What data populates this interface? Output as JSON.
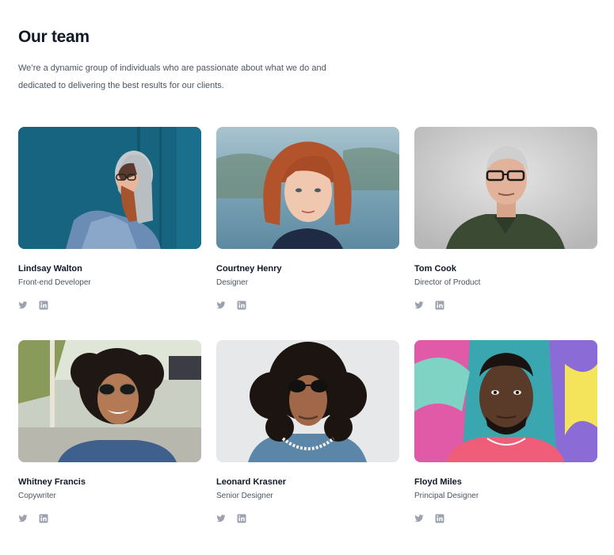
{
  "header": {
    "title": "Our team",
    "subtitle": "We’re a dynamic group of individuals who are passionate about what we do and dedicated to delivering the best results for our clients."
  },
  "team": [
    {
      "name": "Lindsay Walton",
      "role": "Front-end Developer"
    },
    {
      "name": "Courtney Henry",
      "role": "Designer"
    },
    {
      "name": "Tom Cook",
      "role": "Director of Product"
    },
    {
      "name": "Whitney Francis",
      "role": "Copywriter"
    },
    {
      "name": "Leonard Krasner",
      "role": "Senior Designer"
    },
    {
      "name": "Floyd Miles",
      "role": "Principal Designer"
    }
  ],
  "social_icons": [
    "twitter-icon",
    "linkedin-icon"
  ],
  "colors": {
    "heading": "#111827",
    "body_text": "#4b5563",
    "icon": "#9ca3af"
  }
}
